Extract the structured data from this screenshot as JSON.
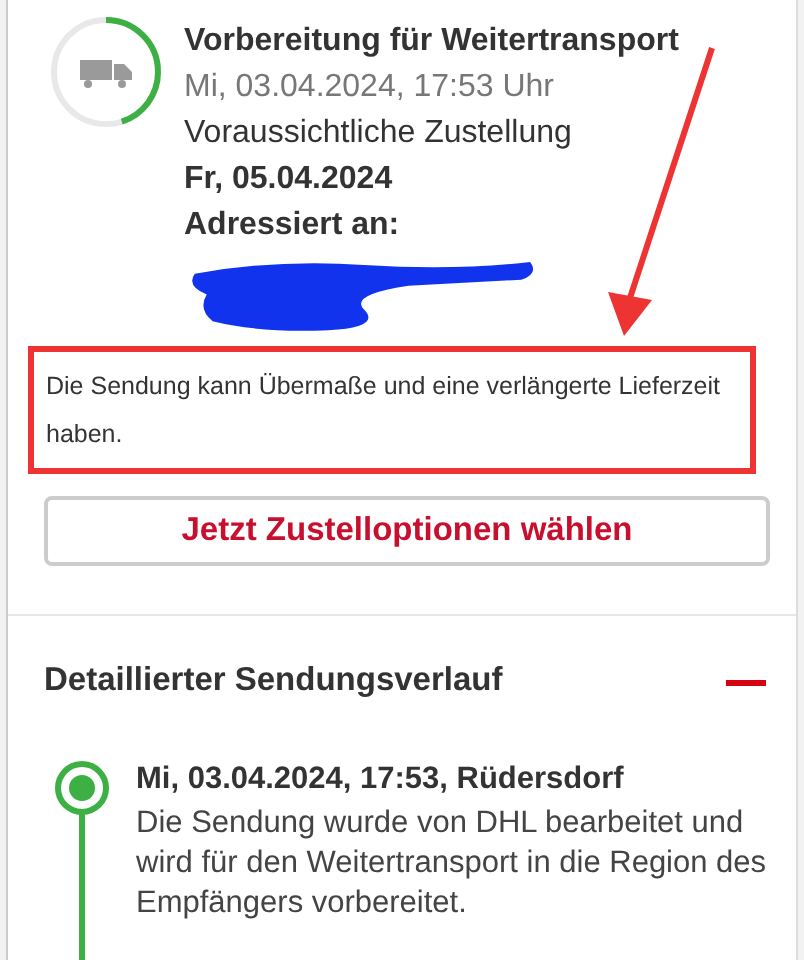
{
  "shipment": {
    "progress": {
      "level": 0.45
    },
    "status": "Vorbereitung für Weitertransport",
    "status_time": "Mi, 03.04.2024, 17:53 Uhr",
    "delivery_label": "Voraussichtliche Zustellung",
    "delivery_date": "Fr, 05.04.2024",
    "addressed_label": "Adressiert an:"
  },
  "notice": "Die Sendung kann Übermaße und eine verlängerte Lieferzeit haben.",
  "action_button": "Jetzt Zustelloptionen wählen",
  "history": {
    "title": "Detaillierter Sendungsverlauf",
    "expanded": true,
    "events": [
      {
        "heading": "Mi, 03.04.2024, 17:53, Rüdersdorf",
        "text": "Die Sendung wurde von DHL bearbeitet und wird für den Weitertransport in die Region des Empfängers vorbereitet.",
        "current": true
      }
    ]
  }
}
